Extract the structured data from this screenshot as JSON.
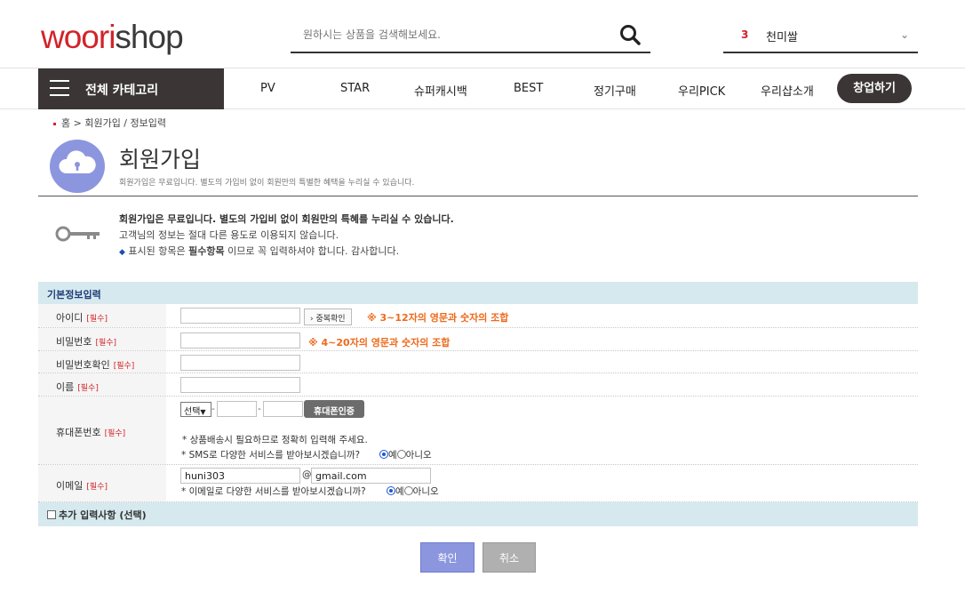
{
  "header": {
    "logo_part1": "woori",
    "logo_part2": "shop",
    "search_placeholder": "원하시는 상품을 검색해보세요.",
    "rank_number": "3",
    "rank_keyword": "천미쌀"
  },
  "nav": {
    "all_category": "전체 카테고리",
    "items": [
      "PV",
      "STAR",
      "슈퍼캐시백",
      "BEST",
      "정기구매",
      "우리PICK",
      "우리샵소개"
    ],
    "start_button": "창업하기"
  },
  "breadcrumb": "홈 > 회원가입 / 정보입력",
  "page": {
    "title": "회원가입",
    "subtitle": "회원가입은 무료입니다. 별도의 가입비 없이 회원만의 특별한 혜택을 누리실 수 있습니다."
  },
  "notice": {
    "line1": "회원가입은 무료입니다. 별도의 가입비 없이 회원만의 특혜를 누리실 수 있습니다.",
    "line2": "고객님의 정보는 절대 다른 용도로 이용되지 않습니다.",
    "line3_pre": "표시된 항목은 ",
    "line3_bold": "필수항목",
    "line3_post": " 이므로 꼭 입력하셔야 합니다. 감사합니다."
  },
  "form": {
    "section_title": "기본정보입력",
    "required_tag": "[필수]",
    "id_label": "아이디",
    "id_check_button": "중복확인",
    "id_hint": "※ 3~12자의 영문과 숫자의 조합",
    "pw_label": "비밀번호",
    "pw_hint": "※ 4~20자의 영문과 숫자의 조합",
    "pw_confirm_label": "비밀번호확인",
    "name_label": "이름",
    "phone_label": "휴대폰번호",
    "phone_select": "선택",
    "phone_dash": "-",
    "phone_verify_button": "휴대폰인증",
    "phone_note": "* 상품배송시 필요하므로 정확히 입력해 주세요.",
    "sms_question": "* SMS로 다양한 서비스를 받아보시겠습니까?",
    "yes": "예",
    "no": "아니오",
    "email_label": "이메일",
    "email_id": "huni303",
    "email_at": "@",
    "email_domain": "gmail.com",
    "email_question": "* 이메일로 다양한 서비스를 받아보시겠습니까?",
    "optional_section": "추가 입력사항 (선택)"
  },
  "buttons": {
    "confirm": "확인",
    "cancel": "취소"
  }
}
